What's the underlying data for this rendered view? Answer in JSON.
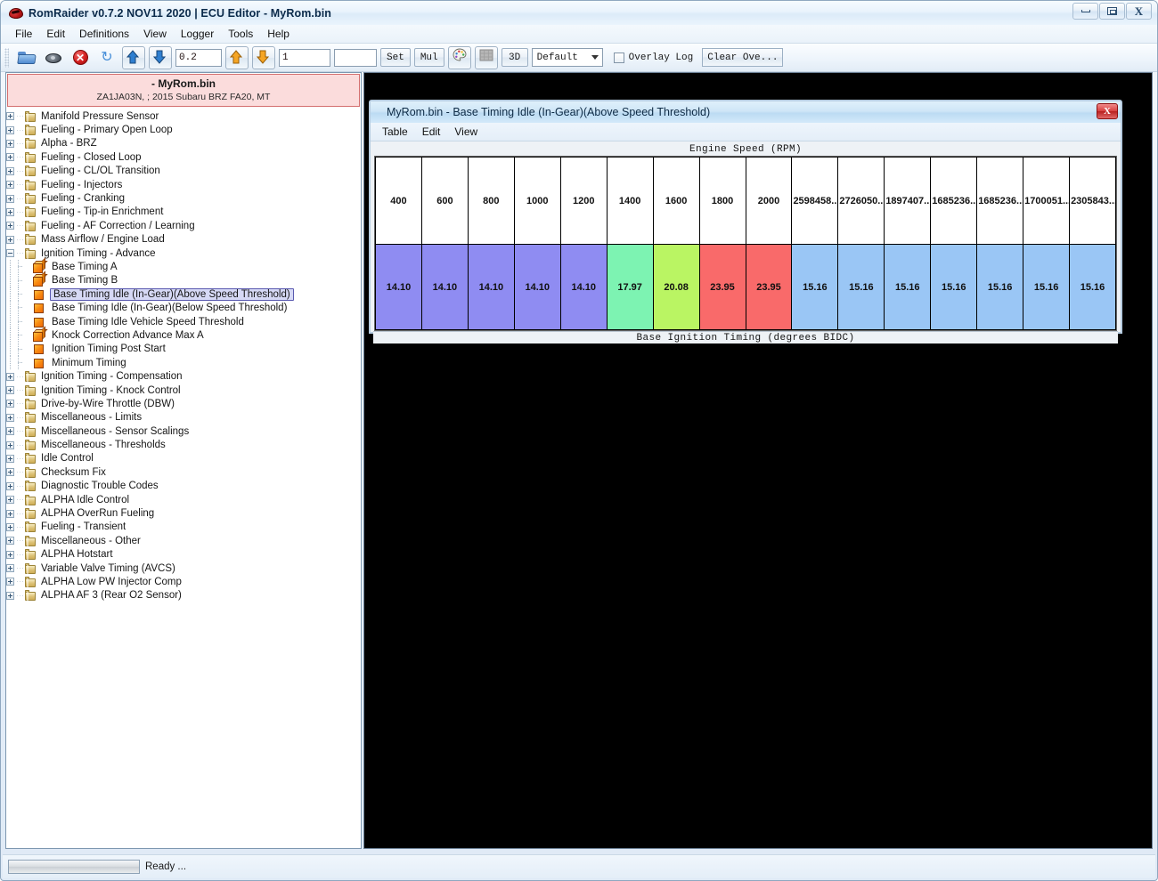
{
  "window": {
    "title": "RomRaider v0.7.2 NOV11 2020 | ECU Editor - MyRom.bin",
    "app_icon": "romraider-icon",
    "minimize_label": "",
    "maximize_label": "",
    "close_label": "X"
  },
  "menubar": {
    "items": [
      {
        "label": "File"
      },
      {
        "label": "Edit"
      },
      {
        "label": "Definitions"
      },
      {
        "label": "View"
      },
      {
        "label": "Logger"
      },
      {
        "label": "Tools"
      },
      {
        "label": "Help"
      }
    ]
  },
  "toolbar": {
    "open_icon": "open-folder-icon",
    "save_icon": "save-disk-icon",
    "close_icon": "close-rom-icon",
    "refresh_icon": "refresh-icon",
    "increment_icon": "blue-arrow-up-icon",
    "decrement_icon": "blue-arrow-down-icon",
    "fine_value": "0.2",
    "coarse_increment_icon": "orange-arrow-up-icon",
    "coarse_decrement_icon": "orange-arrow-down-icon",
    "coarse_value": "1",
    "set_value": "",
    "set_label": "Set",
    "mul_label": "Mul",
    "palette_icon": "color-palette-icon",
    "table_icon": "table-view-icon",
    "threed_label": "3D",
    "layout_selected": "Default",
    "layout_caret": "chevron-down-icon",
    "overlay_log_label": "Overlay Log",
    "overlay_log_checked": false,
    "clear_overlay_label": "Clear Ove..."
  },
  "rom_header": {
    "name": "- MyRom.bin",
    "info": "ZA1JA03N, ; 2015 Subaru BRZ FA20, MT"
  },
  "tree": {
    "items": [
      {
        "label": "Manifold Pressure Sensor",
        "type": "folder",
        "state": "collapsed",
        "depth": 0
      },
      {
        "label": "Fueling - Primary Open Loop",
        "type": "folder",
        "state": "collapsed",
        "depth": 0
      },
      {
        "label": "Alpha - BRZ",
        "type": "folder",
        "state": "collapsed",
        "depth": 0
      },
      {
        "label": "Fueling - Closed Loop",
        "type": "folder",
        "state": "collapsed",
        "depth": 0
      },
      {
        "label": "Fueling - CL/OL Transition",
        "type": "folder",
        "state": "collapsed",
        "depth": 0
      },
      {
        "label": "Fueling - Injectors",
        "type": "folder",
        "state": "collapsed",
        "depth": 0
      },
      {
        "label": "Fueling - Cranking",
        "type": "folder",
        "state": "collapsed",
        "depth": 0
      },
      {
        "label": "Fueling - Tip-in Enrichment",
        "type": "folder",
        "state": "collapsed",
        "depth": 0
      },
      {
        "label": "Fueling - AF Correction / Learning",
        "type": "folder",
        "state": "collapsed",
        "depth": 0
      },
      {
        "label": "Mass Airflow / Engine Load",
        "type": "folder",
        "state": "collapsed",
        "depth": 0
      },
      {
        "label": "Ignition Timing - Advance",
        "type": "folder",
        "state": "expanded",
        "depth": 0
      },
      {
        "label": "Base Timing A",
        "type": "table3d",
        "state": "leaf",
        "depth": 1
      },
      {
        "label": "Base Timing B",
        "type": "table3d",
        "state": "leaf",
        "depth": 1
      },
      {
        "label": "Base Timing Idle (In-Gear)(Above Speed Threshold)",
        "type": "table2d",
        "state": "leaf",
        "depth": 1,
        "selected": true
      },
      {
        "label": "Base Timing Idle (In-Gear)(Below Speed Threshold)",
        "type": "table2d",
        "state": "leaf",
        "depth": 1
      },
      {
        "label": "Base Timing Idle Vehicle Speed Threshold",
        "type": "table2d",
        "state": "leaf",
        "depth": 1
      },
      {
        "label": "Knock Correction Advance Max A",
        "type": "table3d",
        "state": "leaf",
        "depth": 1
      },
      {
        "label": "Ignition Timing Post Start",
        "type": "table2d",
        "state": "leaf",
        "depth": 1
      },
      {
        "label": "Minimum Timing",
        "type": "table2d",
        "state": "leaf",
        "depth": 1
      },
      {
        "label": "Ignition Timing - Compensation",
        "type": "folder",
        "state": "collapsed",
        "depth": 0
      },
      {
        "label": "Ignition Timing - Knock Control",
        "type": "folder",
        "state": "collapsed",
        "depth": 0
      },
      {
        "label": "Drive-by-Wire Throttle (DBW)",
        "type": "folder",
        "state": "collapsed",
        "depth": 0
      },
      {
        "label": "Miscellaneous - Limits",
        "type": "folder",
        "state": "collapsed",
        "depth": 0
      },
      {
        "label": "Miscellaneous - Sensor Scalings",
        "type": "folder",
        "state": "collapsed",
        "depth": 0
      },
      {
        "label": "Miscellaneous - Thresholds",
        "type": "folder",
        "state": "collapsed",
        "depth": 0
      },
      {
        "label": "Idle Control",
        "type": "folder",
        "state": "collapsed",
        "depth": 0
      },
      {
        "label": "Checksum Fix",
        "type": "folder",
        "state": "collapsed",
        "depth": 0
      },
      {
        "label": "Diagnostic Trouble Codes",
        "type": "folder",
        "state": "collapsed",
        "depth": 0
      },
      {
        "label": "ALPHA Idle Control",
        "type": "folder",
        "state": "collapsed",
        "depth": 0
      },
      {
        "label": "ALPHA OverRun Fueling",
        "type": "folder",
        "state": "collapsed",
        "depth": 0
      },
      {
        "label": "Fueling - Transient",
        "type": "folder",
        "state": "collapsed",
        "depth": 0
      },
      {
        "label": "Miscellaneous - Other",
        "type": "folder",
        "state": "collapsed",
        "depth": 0
      },
      {
        "label": "ALPHA Hotstart",
        "type": "folder",
        "state": "collapsed",
        "depth": 0
      },
      {
        "label": "Variable Valve Timing (AVCS)",
        "type": "folder",
        "state": "collapsed",
        "depth": 0
      },
      {
        "label": "ALPHA Low PW Injector Comp",
        "type": "folder",
        "state": "collapsed",
        "depth": 0
      },
      {
        "label": "ALPHA AF 3 (Rear O2 Sensor)",
        "type": "folder",
        "state": "collapsed",
        "depth": 0
      }
    ]
  },
  "table_frame": {
    "title": "MyRom.bin - Base Timing Idle (In-Gear)(Above Speed Threshold)",
    "close_label": "X",
    "menu": [
      {
        "label": "Table"
      },
      {
        "label": "Edit"
      },
      {
        "label": "View"
      }
    ],
    "top_axis_label": "Engine Speed (RPM)",
    "bottom_axis_label": "Base Ignition Timing (degrees BIDC)"
  },
  "chart_data": {
    "type": "table",
    "title": "Base Timing Idle (In-Gear)(Above Speed Threshold)",
    "xlabel": "Engine Speed (RPM)",
    "ylabel": "Base Ignition Timing (degrees BIDC)",
    "categories": [
      "400",
      "600",
      "800",
      "1000",
      "1200",
      "1400",
      "1600",
      "1800",
      "2000",
      "2598458...",
      "2726050...",
      "1897407...",
      "1685236...",
      "1685236...",
      "1700051...",
      "2305843..."
    ],
    "values": [
      "14.10",
      "14.10",
      "14.10",
      "14.10",
      "14.10",
      "17.97",
      "20.08",
      "23.95",
      "23.95",
      "15.16",
      "15.16",
      "15.16",
      "15.16",
      "15.16",
      "15.16",
      "15.16"
    ],
    "cell_colors": [
      "#8f8cf2",
      "#8f8cf2",
      "#8f8cf2",
      "#8f8cf2",
      "#8f8cf2",
      "#7df3b2",
      "#baf563",
      "#f96a6a",
      "#f96a6a",
      "#9ac6f5",
      "#9ac6f5",
      "#9ac6f5",
      "#9ac6f5",
      "#9ac6f5",
      "#9ac6f5",
      "#9ac6f5"
    ]
  },
  "statusbar": {
    "progress_value": "",
    "status_text": "Ready ..."
  }
}
